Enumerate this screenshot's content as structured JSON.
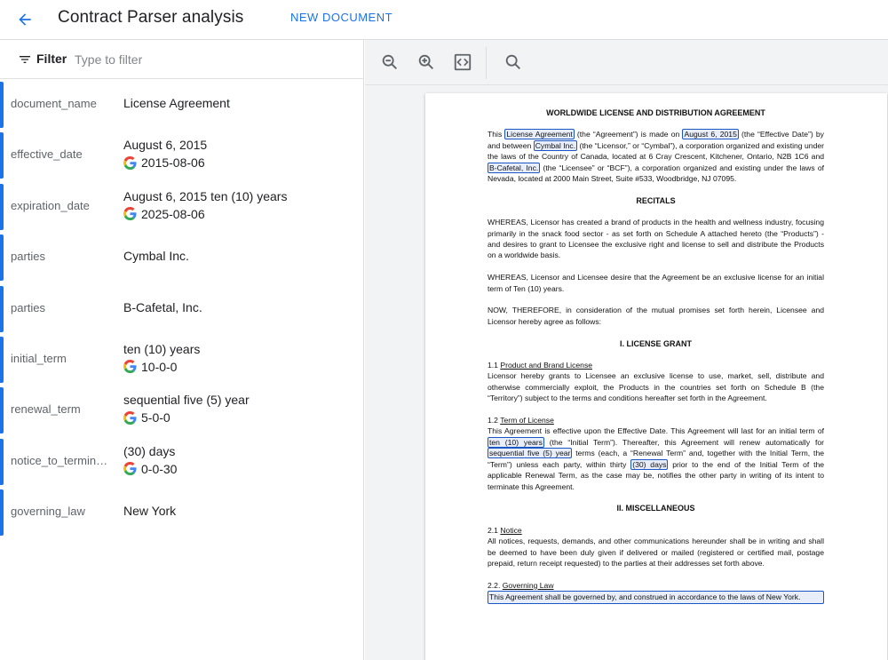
{
  "header": {
    "title": "Contract Parser analysis",
    "new_document": "NEW DOCUMENT"
  },
  "filter": {
    "label": "Filter",
    "placeholder": "Type to filter"
  },
  "entities": [
    {
      "key": "document_name",
      "value": "License Agreement",
      "normalized": ""
    },
    {
      "key": "effective_date",
      "value": "August 6, 2015",
      "normalized": "2015-08-06"
    },
    {
      "key": "expiration_date",
      "value": "August 6, 2015 ten (10) years",
      "normalized": "2025-08-06"
    },
    {
      "key": "parties",
      "value": "Cymbal Inc.",
      "normalized": ""
    },
    {
      "key": "parties",
      "value": "B-Cafetal, Inc.",
      "normalized": ""
    },
    {
      "key": "initial_term",
      "value": "ten (10) years",
      "normalized": "10-0-0"
    },
    {
      "key": "renewal_term",
      "value": "sequential five (5) year",
      "normalized": "5-0-0"
    },
    {
      "key": "notice_to_terminat...",
      "value": "(30) days",
      "normalized": "0-0-30"
    },
    {
      "key": "governing_law",
      "value": "New York",
      "normalized": ""
    }
  ],
  "toolbar": {
    "icons": [
      "zoom-out-icon",
      "zoom-in-icon",
      "fit-to-page-icon",
      "search-icon"
    ]
  },
  "document": {
    "title": "WORLDWIDE LICENSE AND DISTRIBUTION AGREEMENT",
    "p1_a": "This ",
    "p1_name": "License Agreement",
    "p1_b": " (the “Agreement”) is made on ",
    "p1_date": "August 6, 2015",
    "p1_c": " (the “Effective Date”) by and between ",
    "p1_party1": "Cymbal Inc.",
    "p1_d": " (the “Licensor,” or “Cymbal”), a corporation organized and existing under the laws of the Country of Canada, located at 6 Cray Crescent, Kitchener, Ontario, N2B 1C6 and ",
    "p1_party2": "B-Cafetal, Inc.",
    "p1_e": " (the “Licensee” or “BCF”), a corporation organized and existing under the laws of Nevada, located at 2000 Main Street, Suite #533, Woodbridge, NJ 07095.",
    "recitals": "RECITALS",
    "p2": "WHEREAS, Licensor has created a brand of products in the health and wellness industry, focusing primarily in the snack food sector - as set forth on Schedule A attached hereto (the “Products”) - and desires to grant to Licensee the exclusive right and license to sell and distribute the Products on a worldwide basis.",
    "p3": "WHEREAS, Licensor and Licensee desire that the Agreement be an exclusive license for an initial term of Ten (10) years.",
    "p4": "NOW, THEREFORE, in consideration of the mutual promises set forth herein, Licensee and Licensor hereby agree as follows:",
    "sec1": "I.  LICENSE GRANT",
    "s11_num": "1.1  ",
    "s11_title": "Product and Brand License",
    "s11_body": "Licensor hereby grants to Licensee an exclusive license to use, market, sell, distribute and otherwise commercially exploit, the Products in the countries set forth on Schedule B (the “Territory”) subject to the terms and conditions hereafter set forth in the Agreement.",
    "s12_num": "1.2  ",
    "s12_title": "Term of License",
    "s12_a": "This Agreement is effective upon the Effective Date. This Agreement will last for an initial term of ",
    "s12_term": "ten (10) years",
    "s12_b": " (the “Initial Term”). Thereafter, this Agreement will renew automatically for ",
    "s12_renew": "sequential five (5) year",
    "s12_c": " terms (each, a “Renewal Term” and, together with the Initial Term, the “Term”) unless each party, within thirty ",
    "s12_days": "(30) days",
    "s12_d": " prior to the end of the Initial Term of the applicable Renewal Term, as the case may be, notifies the other party in writing of its intent to terminate this Agreement.",
    "sec2": "II. MISCELLANEOUS",
    "s21_num": "2.1 ",
    "s21_title": "Notice",
    "s21_body": "All notices, requests, demands, and other communications hereunder shall be in writing and shall be deemed to have been duly given if delivered or mailed (registered or certified mail, postage prepaid, return receipt requested) to the parties at their addresses set forth above.",
    "s22_num": "2.2.  ",
    "s22_title": "Governing Law",
    "s22_body": "This Agreement shall be governed by, and construed in accordance to the laws of New York."
  }
}
